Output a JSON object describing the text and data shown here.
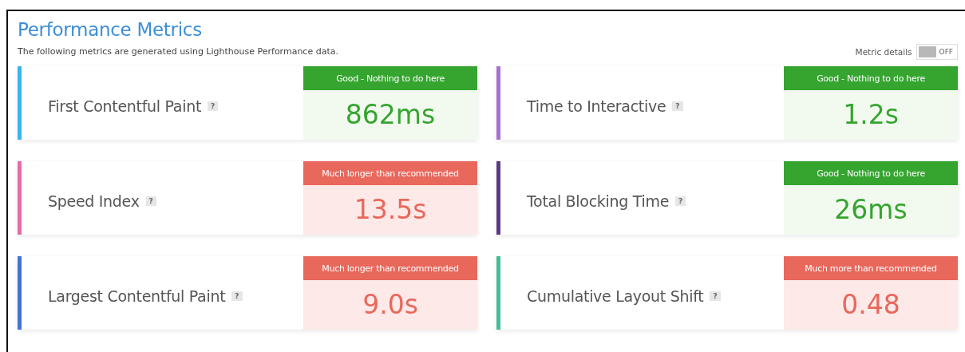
{
  "title": "Performance Metrics",
  "subtitle": "The following metrics are generated using Lighthouse Performance data.",
  "details_toggle": {
    "label": "Metric details",
    "state_text": "OFF",
    "on": false
  },
  "metrics": [
    {
      "name": "First Contentful Paint",
      "help": "?",
      "color": "#3bb4ea",
      "kind": "good",
      "status": "Good - Nothing to do here",
      "value": "862ms"
    },
    {
      "name": "Time to Interactive",
      "help": "?",
      "color": "#a86fd0",
      "kind": "good",
      "status": "Good - Nothing to do here",
      "value": "1.2s"
    },
    {
      "name": "Speed Index",
      "help": "?",
      "color": "#ea6aa8",
      "kind": "bad",
      "status": "Much longer than recommended",
      "value": "13.5s"
    },
    {
      "name": "Total Blocking Time",
      "help": "?",
      "color": "#5a3a86",
      "kind": "good",
      "status": "Good - Nothing to do here",
      "value": "26ms"
    },
    {
      "name": "Largest Contentful Paint",
      "help": "?",
      "color": "#3f74d8",
      "kind": "bad",
      "status": "Much longer than recommended",
      "value": "9.0s"
    },
    {
      "name": "Cumulative Layout Shift",
      "help": "?",
      "color": "#3fbf98",
      "kind": "bad",
      "status": "Much more than recommended",
      "value": "0.48"
    }
  ]
}
